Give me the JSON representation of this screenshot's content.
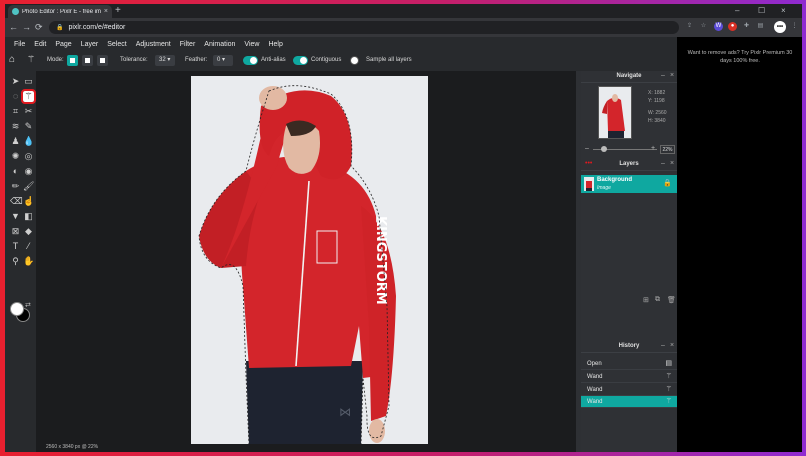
{
  "browser": {
    "tab_title": "Photo Editor : Pixlr E - free image...",
    "tab_close": "×",
    "new_tab": "+",
    "url": "pixlr.com/e/#editor",
    "window_controls": [
      "–",
      "☐",
      "×"
    ],
    "nav": {
      "back": "←",
      "forward": "→",
      "reload": "⟳"
    },
    "profile_initial": "•••"
  },
  "menu": [
    "File",
    "Edit",
    "Page",
    "Layer",
    "Select",
    "Adjustment",
    "Filter",
    "Animation",
    "View",
    "Help"
  ],
  "options": {
    "mode_label": "Mode:",
    "tolerance_label": "Tolerance:",
    "tolerance_value": "32 ▾",
    "feather_label": "Feather:",
    "feather_value": "0 ▾",
    "antialias_label": "Anti-alias",
    "contiguous_label": "Contiguous",
    "sample_label": "Sample all layers"
  },
  "status": {
    "text": "2560 x 3840 px @ 22%"
  },
  "navigate": {
    "title": "Navigate",
    "x_label": "X:",
    "x_value": "1882",
    "y_label": "Y:",
    "y_value": "1198",
    "w_label": "W:",
    "w_value": "2560",
    "h_label": "H:",
    "h_value": "3840",
    "zoom": "22%",
    "zoom_fraction": 0.22,
    "minus": "–",
    "plus": "+"
  },
  "layers": {
    "title": "Layers",
    "items": [
      {
        "name": "Background",
        "type": "Image"
      }
    ]
  },
  "history": {
    "title": "History",
    "items": [
      "Open",
      "Wand",
      "Wand",
      "Wand"
    ]
  },
  "ad": {
    "text": "Want to remove ads? Try Pixlr Premium 30 days 100% free."
  },
  "colors": {
    "accent": "#0fa8a0",
    "jacket": "#d3252b",
    "highlight": "#e0191f"
  }
}
